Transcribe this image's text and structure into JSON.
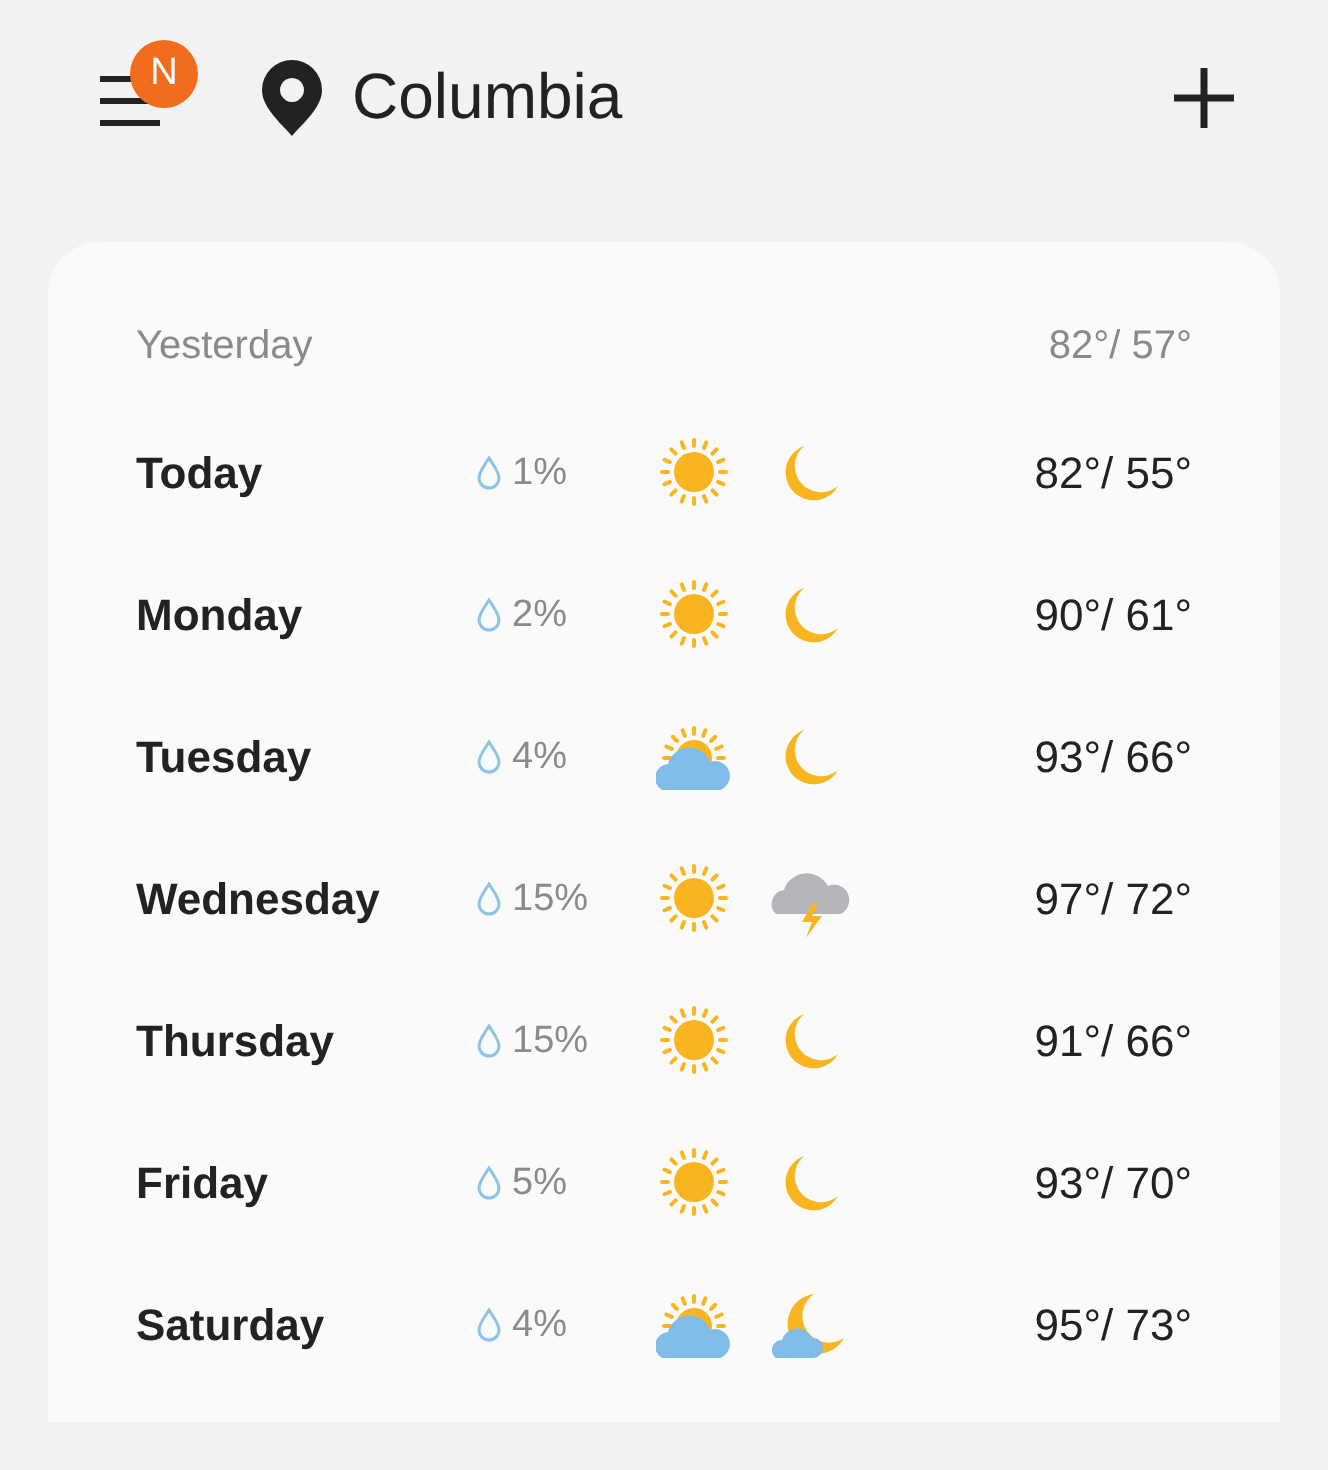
{
  "header": {
    "badge": "N",
    "location": "Columbia"
  },
  "yesterday": {
    "label": "Yesterday",
    "temps": "82°/ 57°"
  },
  "days": [
    {
      "name": "Today",
      "precip": "1%",
      "icons": [
        {
          "kind": "sun"
        },
        {
          "kind": "moon"
        }
      ],
      "temps": "82°/ 55°"
    },
    {
      "name": "Monday",
      "precip": "2%",
      "icons": [
        {
          "kind": "sun"
        },
        {
          "kind": "moon"
        }
      ],
      "temps": "90°/ 61°"
    },
    {
      "name": "Tuesday",
      "precip": "4%",
      "icons": [
        {
          "kind": "partly-sunny"
        },
        {
          "kind": "moon"
        }
      ],
      "temps": "93°/ 66°"
    },
    {
      "name": "Wednesday",
      "precip": "15%",
      "icons": [
        {
          "kind": "sun"
        },
        {
          "kind": "storm"
        }
      ],
      "temps": "97°/ 72°"
    },
    {
      "name": "Thursday",
      "precip": "15%",
      "icons": [
        {
          "kind": "sun"
        },
        {
          "kind": "moon"
        }
      ],
      "temps": "91°/ 66°"
    },
    {
      "name": "Friday",
      "precip": "5%",
      "icons": [
        {
          "kind": "sun"
        },
        {
          "kind": "moon"
        }
      ],
      "temps": "93°/ 70°"
    },
    {
      "name": "Saturday",
      "precip": "4%",
      "icons": [
        {
          "kind": "partly-sunny"
        },
        {
          "kind": "cloudy-moon"
        }
      ],
      "temps": "95°/ 73°"
    }
  ]
}
